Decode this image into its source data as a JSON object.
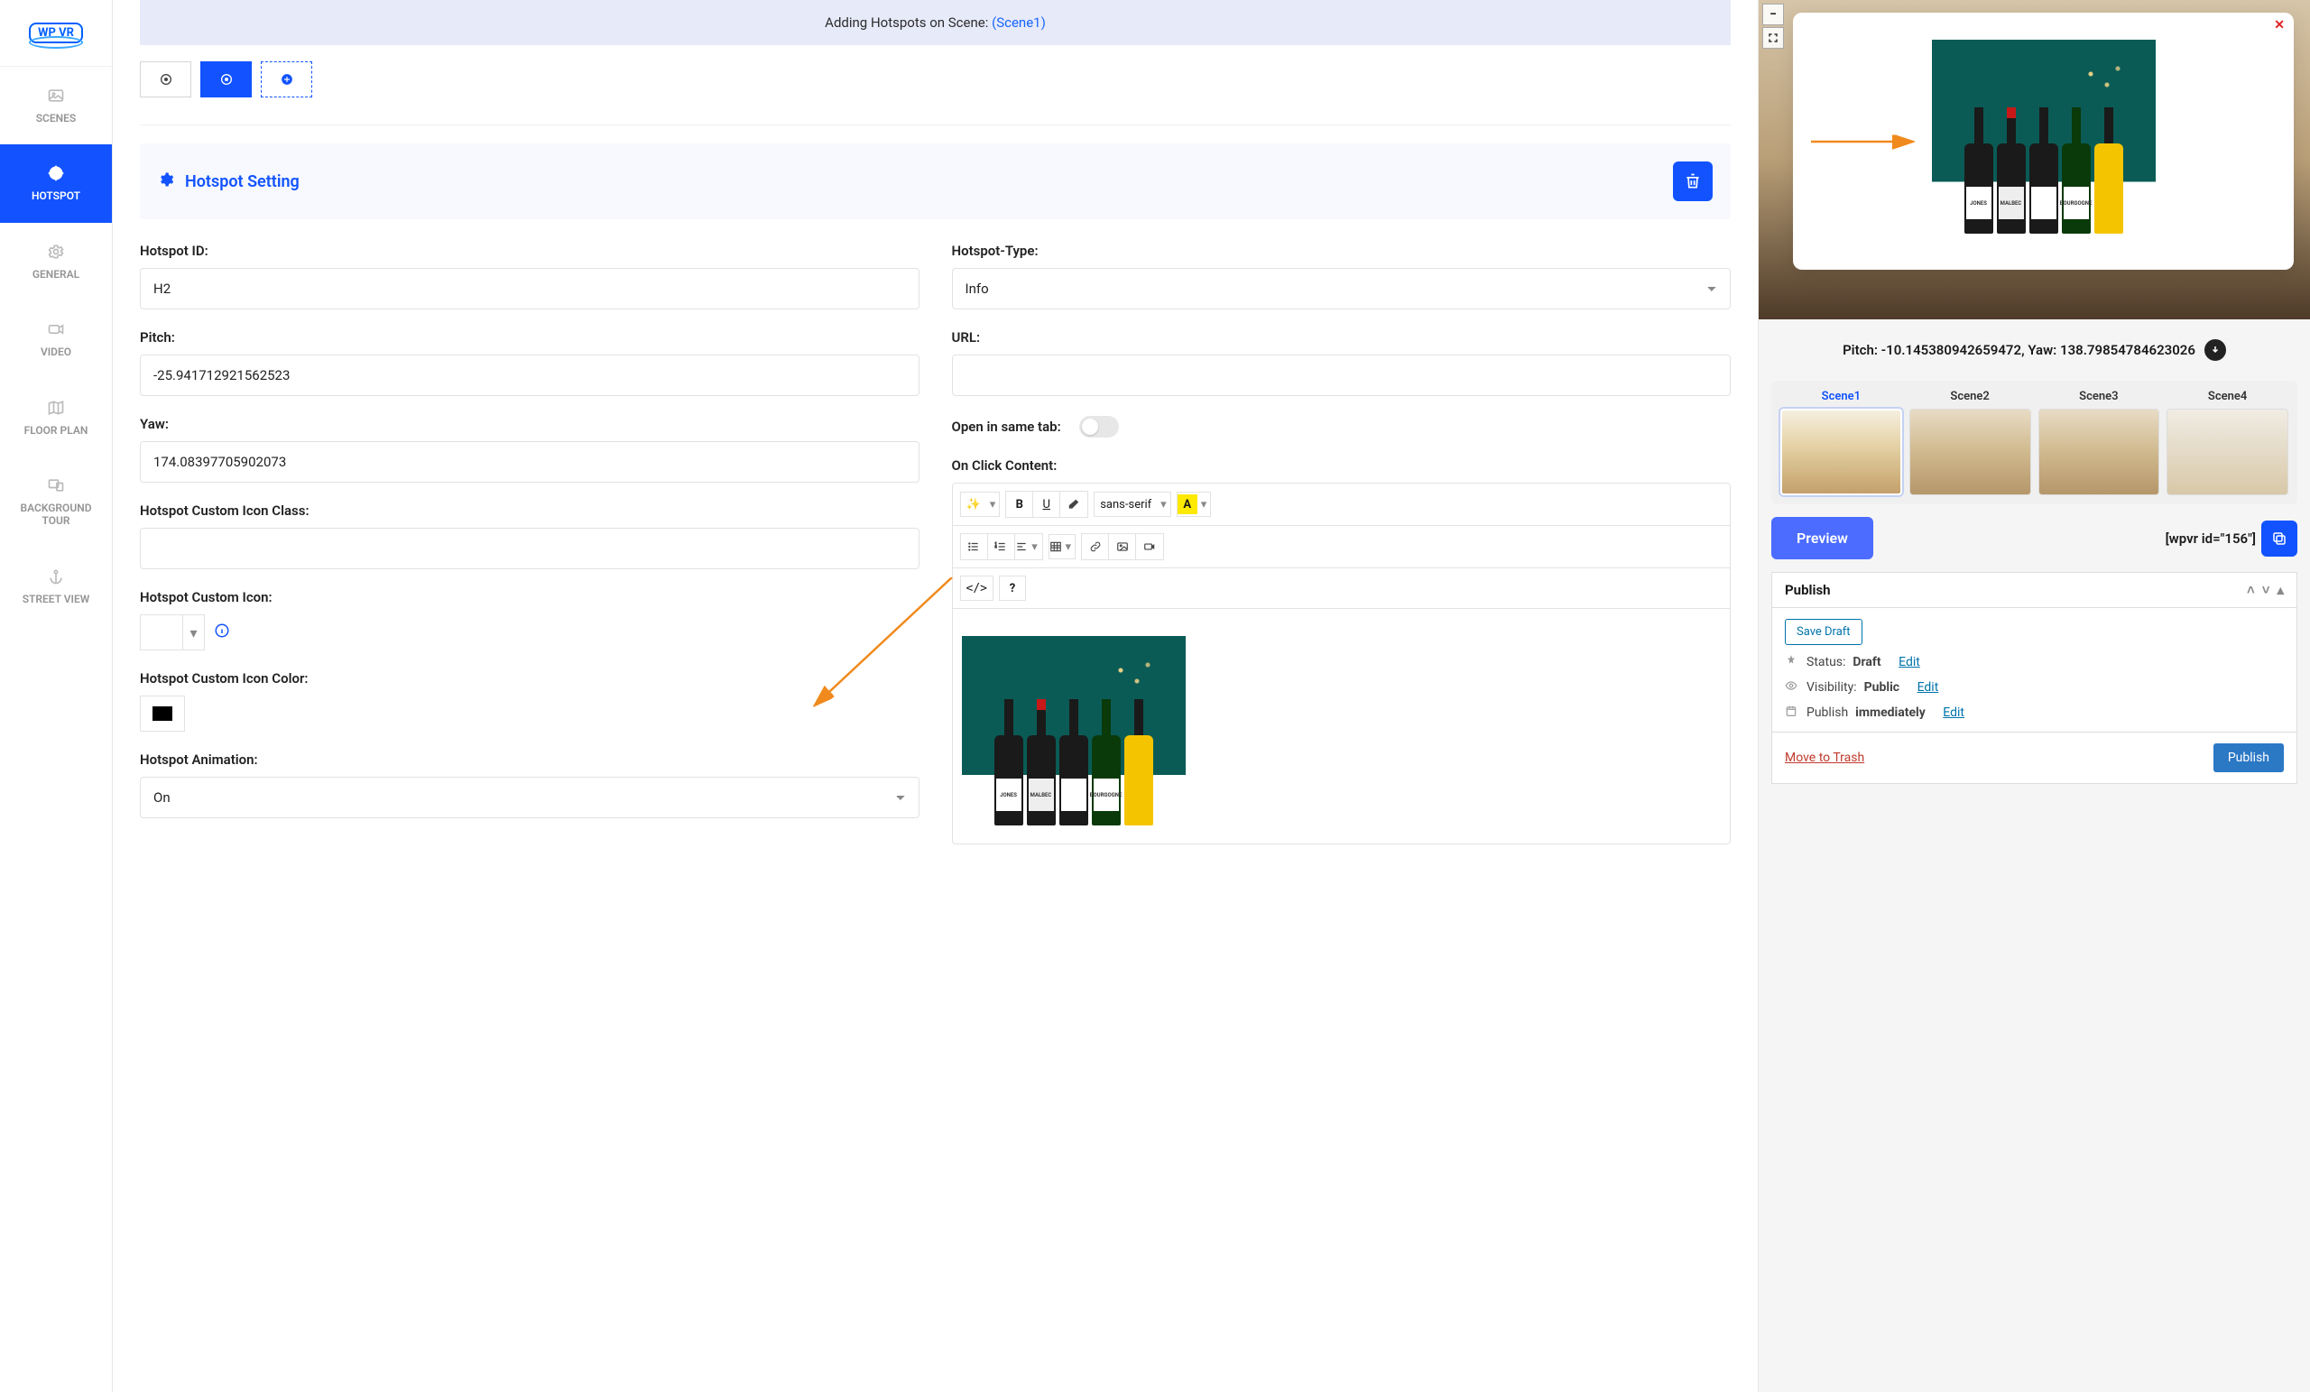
{
  "logo": "WP VR",
  "sidebar": {
    "items": [
      {
        "label": "SCENES"
      },
      {
        "label": "HOTSPOT"
      },
      {
        "label": "GENERAL"
      },
      {
        "label": "VIDEO"
      },
      {
        "label": "FLOOR PLAN"
      },
      {
        "label": "BACKGROUND TOUR"
      },
      {
        "label": "STREET VIEW"
      }
    ]
  },
  "banner": {
    "prefix": "Adding Hotspots on Scene: ",
    "scene_link": "(Scene1)"
  },
  "hotspot_setting_title": "Hotspot Setting",
  "form": {
    "hotspot_id": {
      "label": "Hotspot ID:",
      "value": "H2"
    },
    "hotspot_type": {
      "label": "Hotspot-Type:",
      "value": "Info"
    },
    "pitch": {
      "label": "Pitch:",
      "value": "-25.941712921562523"
    },
    "url": {
      "label": "URL:",
      "value": ""
    },
    "yaw": {
      "label": "Yaw:",
      "value": "174.08397705902073"
    },
    "open_same_tab": {
      "label": "Open in same tab:"
    },
    "custom_icon_class": {
      "label": "Hotspot Custom Icon Class:",
      "value": ""
    },
    "on_click_content": {
      "label": "On Click Content:"
    },
    "custom_icon": {
      "label": "Hotspot Custom Icon:"
    },
    "custom_icon_color": {
      "label": "Hotspot Custom Icon Color:",
      "value": "#000000"
    },
    "hotspot_animation": {
      "label": "Hotspot Animation:",
      "value": "On"
    }
  },
  "rte": {
    "font_family": "sans-serif",
    "bottle_labels": [
      "JONES",
      "MALBEC",
      "",
      "BOURGOGNE",
      ""
    ]
  },
  "preview": {
    "pitch_yaw_label": "Pitch: -10.145380942659472, Yaw: 138.79854784623026",
    "scenes": [
      {
        "label": "Scene1",
        "active": true
      },
      {
        "label": "Scene2"
      },
      {
        "label": "Scene3"
      },
      {
        "label": "Scene4"
      }
    ],
    "preview_btn": "Preview",
    "shortcode": "[wpvr id=\"156\"]"
  },
  "publish": {
    "title": "Publish",
    "save_draft": "Save Draft",
    "status_label": "Status: ",
    "status_value": "Draft",
    "visibility_label": "Visibility: ",
    "visibility_value": "Public",
    "schedule_label": "Publish ",
    "schedule_value": "immediately",
    "edit": "Edit",
    "move_trash": "Move to Trash",
    "publish_btn": "Publish"
  }
}
